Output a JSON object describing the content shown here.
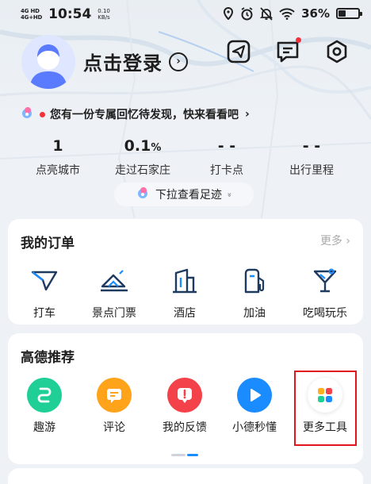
{
  "status_bar": {
    "signal_top": "4G HD",
    "signal_bottom": "4G+HD",
    "time": "10:54",
    "speed_value": "0.10",
    "speed_unit": "KB/s",
    "battery": "36%",
    "battery_level": 0.36
  },
  "header": {
    "login_text": "点击登录",
    "login_arrow": "›",
    "has_unread_message": true
  },
  "memory_banner": {
    "text": "您有一份专属回忆待发现，快来看看吧",
    "chevron": "›"
  },
  "stats": [
    {
      "value": "1",
      "unit": "",
      "label": "点亮城市"
    },
    {
      "value": "0.1",
      "unit": "%",
      "label": "走过石家庄"
    },
    {
      "value": "- -",
      "unit": "",
      "label": "打卡点"
    },
    {
      "value": "- -",
      "unit": "",
      "label": "出行里程"
    }
  ],
  "pull_hint": {
    "text": "下拉查看足迹",
    "chevron": "»"
  },
  "orders": {
    "title": "我的订单",
    "more": "更多 ›",
    "items": [
      {
        "label": "打车",
        "icon": "taxi-icon"
      },
      {
        "label": "景点门票",
        "icon": "ticket-icon"
      },
      {
        "label": "酒店",
        "icon": "hotel-icon"
      },
      {
        "label": "加油",
        "icon": "fuel-icon"
      },
      {
        "label": "吃喝玩乐",
        "icon": "cocktail-icon"
      }
    ]
  },
  "recommend": {
    "title": "高德推荐",
    "items": [
      {
        "label": "趣游",
        "icon": "route-icon",
        "color": "#1fcf96"
      },
      {
        "label": "评论",
        "icon": "comment-icon",
        "color": "#ffa31a"
      },
      {
        "label": "我的反馈",
        "icon": "feedback-icon",
        "color": "#f4424b"
      },
      {
        "label": "小德秒懂",
        "icon": "play-icon",
        "color": "#1a8cff"
      },
      {
        "label": "更多工具",
        "icon": "apps-grid-icon",
        "color": "#ffffff"
      }
    ],
    "highlighted_item": "更多工具"
  },
  "colors": {
    "accent_blue": "#1a8cff",
    "badge_red": "#f2313a",
    "highlight_red": "#e0161c"
  }
}
